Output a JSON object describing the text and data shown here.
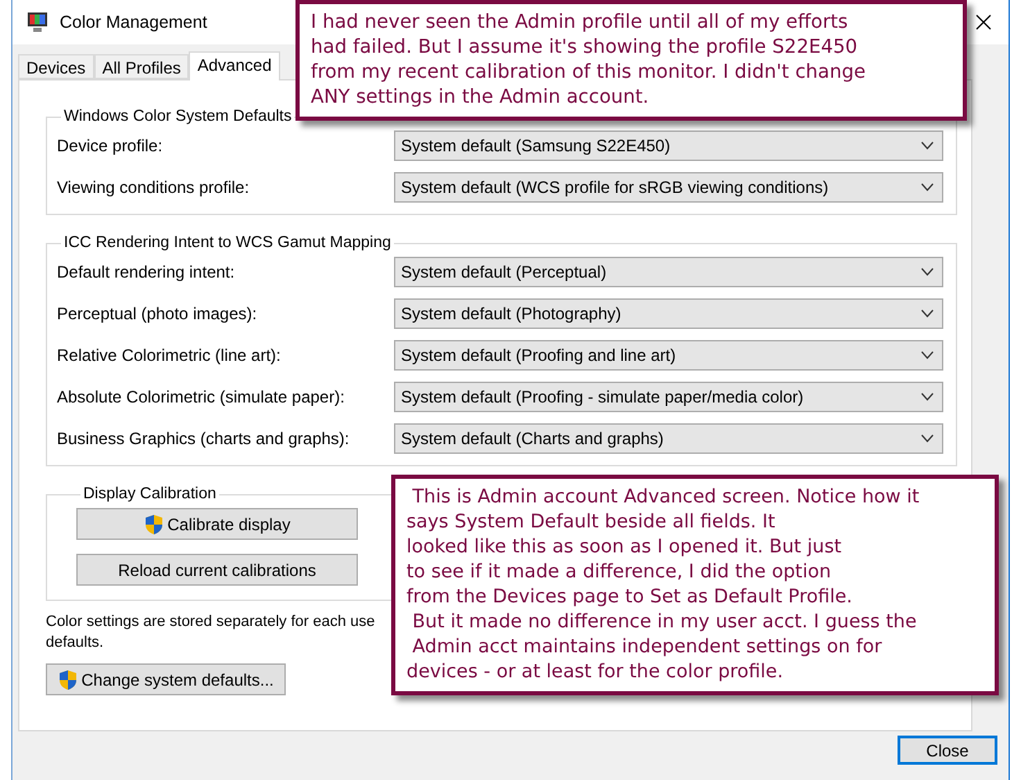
{
  "window": {
    "title": "Color Management"
  },
  "tabs": [
    {
      "label": "Devices",
      "selected": false
    },
    {
      "label": "All Profiles",
      "selected": false
    },
    {
      "label": "Advanced",
      "selected": true
    }
  ],
  "groups": [
    {
      "title": "Windows Color System Defaults",
      "rows": [
        {
          "label": "Device profile:",
          "value": "System default (Samsung S22E450)"
        },
        {
          "label": "Viewing conditions profile:",
          "value": "System default (WCS profile for sRGB viewing conditions)"
        }
      ]
    },
    {
      "title": "ICC Rendering Intent to WCS Gamut Mapping",
      "rows": [
        {
          "label": "Default rendering intent:",
          "value": "System default (Perceptual)"
        },
        {
          "label": "Perceptual (photo images):",
          "value": "System default (Photography)"
        },
        {
          "label": "Relative Colorimetric (line art):",
          "value": "System default (Proofing and line art)"
        },
        {
          "label": "Absolute Colorimetric (simulate paper):",
          "value": "System default (Proofing - simulate paper/media color)"
        },
        {
          "label": "Business Graphics (charts and graphs):",
          "value": "System default (Charts and graphs)"
        }
      ]
    }
  ],
  "calibration": {
    "title": "Display Calibration",
    "buttons": [
      {
        "label": "Calibrate display",
        "shield": true
      },
      {
        "label": "Reload current calibrations",
        "shield": false
      }
    ]
  },
  "note": "Color settings are stored separately for each use defaults.",
  "change_button": {
    "label": "Change system defaults...",
    "shield": true
  },
  "close_button": "Close",
  "callouts": [
    {
      "lines": [
        "I had never seen the Admin profile until all of my efforts",
        "had failed. But I assume it's showing the profile S22E450",
        "from my recent calibration of this monitor. I didn't change",
        "ANY settings in the Admin account."
      ]
    },
    {
      "lines": [
        " This is Admin account Advanced screen. Notice how it",
        "says System Default beside all fields. It",
        "looked like this as soon as I opened it. But just",
        "to see if it made a difference, I did the option",
        "from the Devices page to Set as Default Profile.",
        " But it made no difference in my user acct. I guess the",
        " Admin acct maintains independent settings on for",
        "devices - or at least for the color profile."
      ]
    }
  ]
}
